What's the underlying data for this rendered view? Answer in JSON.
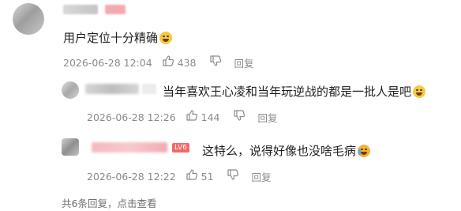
{
  "comment": {
    "text": "用户定位十分精确",
    "emoji_icon": "laugh-emoji-icon",
    "date": "2026-06-28 12:04",
    "likes": "438",
    "reply_label": "回复"
  },
  "replies": [
    {
      "text": "当年喜欢王心凌和当年玩逆战的都是一批人是吧",
      "emoji_icon": "laugh-emoji-icon",
      "date": "2026-06-28 12:26",
      "likes": "144",
      "reply_label": "回复"
    },
    {
      "text": "这特么，说得好像也没啥毛病",
      "emoji_icon": "crying-emoji-icon",
      "level_badge": "LV6",
      "date": "2026-06-28 12:22",
      "likes": "51",
      "reply_label": "回复"
    }
  ],
  "footer": {
    "summary": "共6条回复，",
    "action": "点击查看"
  },
  "icons": {
    "like": "thumb-up-icon",
    "dislike": "thumb-down-icon"
  },
  "colors": {
    "text": "#1f1f1f",
    "meta": "#8a8a8a",
    "name_blur_pink": "#f5b8bf"
  }
}
